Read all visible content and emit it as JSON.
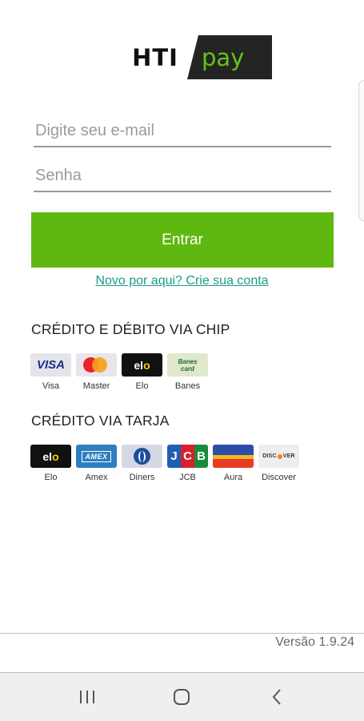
{
  "logo": {
    "left": "HTI",
    "right": "pay"
  },
  "login": {
    "email_placeholder": "Digite seu e-mail",
    "password_placeholder": "Senha",
    "submit_label": "Entrar",
    "signup_link": "Novo por aqui? Crie sua conta"
  },
  "chip_section": {
    "title": "CRÉDITO E DÉBITO VIA CHIP",
    "cards": [
      {
        "label": "Visa",
        "icon": "visa-icon"
      },
      {
        "label": "Master",
        "icon": "mastercard-icon"
      },
      {
        "label": "Elo",
        "icon": "elo-icon"
      },
      {
        "label": "Banes",
        "icon": "banescard-icon"
      }
    ]
  },
  "stripe_section": {
    "title": "CRÉDITO VIA TARJA",
    "cards": [
      {
        "label": "Elo",
        "icon": "elo-icon"
      },
      {
        "label": "Amex",
        "icon": "amex-icon"
      },
      {
        "label": "Diners",
        "icon": "diners-icon"
      },
      {
        "label": "JCB",
        "icon": "jcb-icon"
      },
      {
        "label": "Aura",
        "icon": "aura-icon"
      },
      {
        "label": "Discover",
        "icon": "discover-icon"
      }
    ]
  },
  "card_logo_text": {
    "visa": "VISA",
    "elo_e": "el",
    "elo_o": "o",
    "banes_line1": "Banes",
    "banes_line2": "card",
    "amex": "AMEX",
    "jcb_j": "J",
    "jcb_c": "C",
    "jcb_b": "B",
    "discover_a": "DISC",
    "discover_b": "VER"
  },
  "footer": {
    "version": "Versão 1.9.24"
  },
  "navbar": {
    "buttons": [
      "recents-icon",
      "home-icon",
      "back-icon"
    ]
  },
  "colors": {
    "brand_green": "#5fb80f",
    "link_teal": "#1b9c8c",
    "logo_dark": "#242424"
  }
}
